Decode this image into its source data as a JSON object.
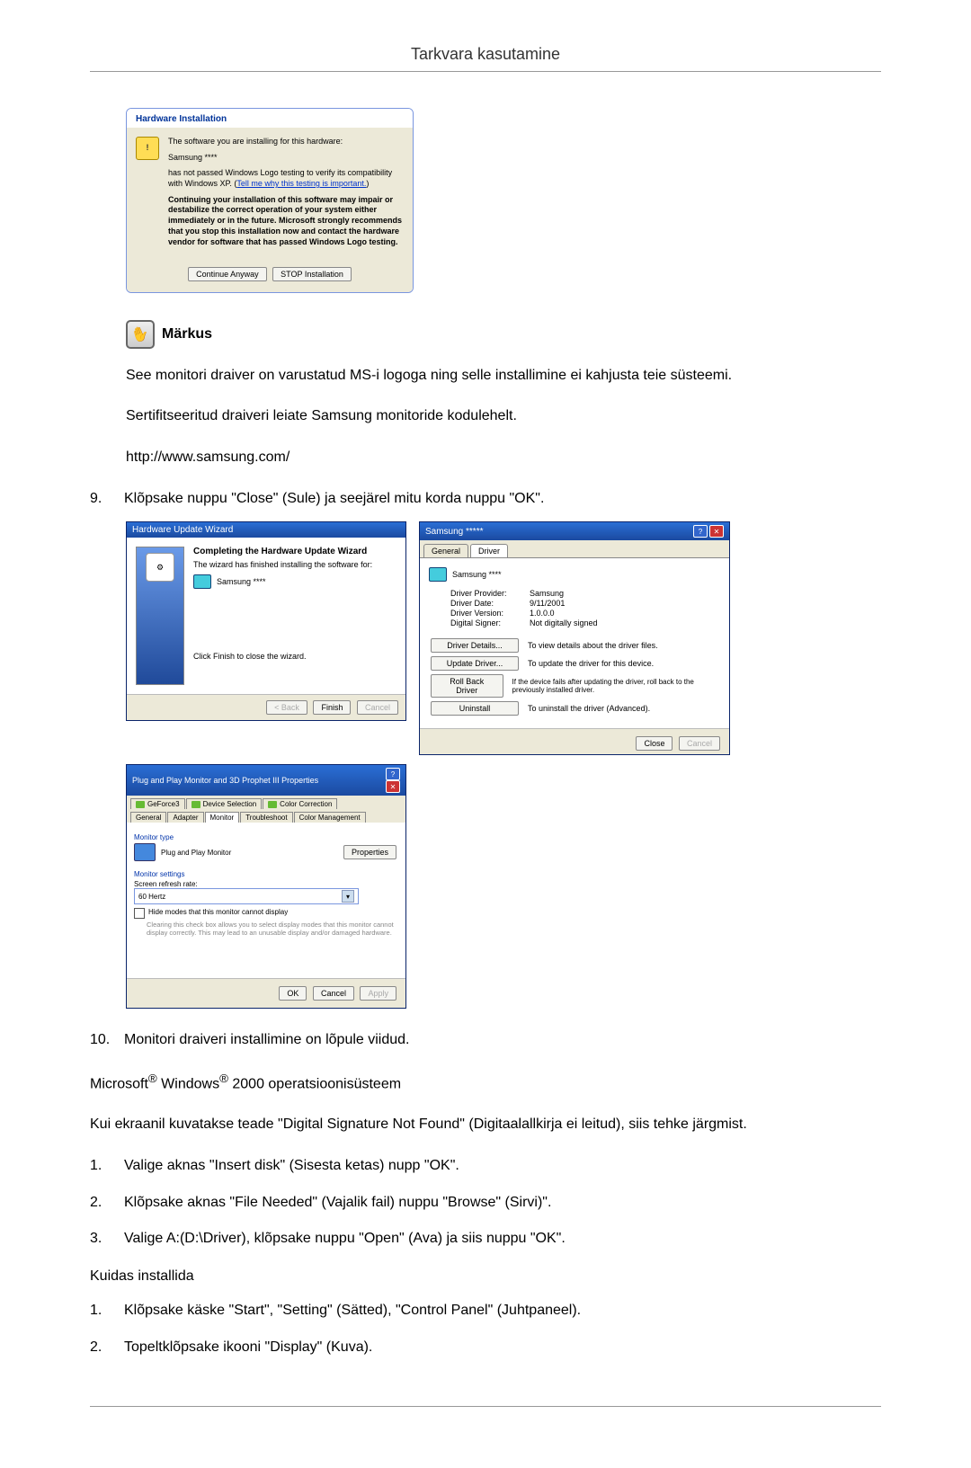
{
  "header": {
    "title": "Tarkvara kasutamine"
  },
  "hw_install": {
    "title": "Hardware Installation",
    "line1": "The software you are installing for this hardware:",
    "device": "Samsung ****",
    "line2a": "has not passed Windows Logo testing to verify its compatibility with Windows XP. (",
    "line2_link": "Tell me why this testing is important.",
    "line2b": ")",
    "bold_text": "Continuing your installation of this software may impair or destabilize the correct operation of your system either immediately or in the future. Microsoft strongly recommends that you stop this installation now and contact the hardware vendor for software that has passed Windows Logo testing.",
    "btn_continue": "Continue Anyway",
    "btn_stop": "STOP Installation"
  },
  "note": {
    "label": "Märkus",
    "para1": "See monitori draiver on varustatud MS-i logoga ning selle installimine ei kahjusta teie süsteemi.",
    "para2": "Sertifitseeritud draiveri leiate Samsung monitoride kodulehelt.",
    "url": "http://www.samsung.com/"
  },
  "step9_num": "9.",
  "step9": "Klõpsake nuppu \"Close\" (Sule) ja seejärel mitu korda nuppu \"OK\".",
  "wizard": {
    "title": "Hardware Update Wizard",
    "heading": "Completing the Hardware Update Wizard",
    "line1": "The wizard has finished installing the software for:",
    "device": "Samsung ****",
    "finish_hint": "Click Finish to close the wizard.",
    "btn_back": "< Back",
    "btn_finish": "Finish",
    "btn_cancel": "Cancel"
  },
  "driver": {
    "title": "Samsung *****",
    "tab_general": "General",
    "tab_driver": "Driver",
    "device": "Samsung ****",
    "provider_l": "Driver Provider:",
    "provider_v": "Samsung",
    "date_l": "Driver Date:",
    "date_v": "9/11/2001",
    "ver_l": "Driver Version:",
    "ver_v": "1.0.0.0",
    "signer_l": "Digital Signer:",
    "signer_v": "Not digitally signed",
    "btn_details": "Driver Details...",
    "btn_details_desc": "To view details about the driver files.",
    "btn_update": "Update Driver...",
    "btn_update_desc": "To update the driver for this device.",
    "btn_rollback": "Roll Back Driver",
    "btn_rollback_desc": "If the device fails after updating the driver, roll back to the previously installed driver.",
    "btn_uninstall": "Uninstall",
    "btn_uninstall_desc": "To uninstall the driver (Advanced).",
    "btn_close": "Close",
    "btn_cancel": "Cancel"
  },
  "monitor": {
    "title": "Plug and Play Monitor and 3D Prophet III Properties",
    "t_geforce": "GeForce3",
    "t_devsel": "Device Selection",
    "t_colorcorr": "Color Correction",
    "t_general": "General",
    "t_adapter": "Adapter",
    "t_monitor": "Monitor",
    "t_troubleshoot": "Troubleshoot",
    "t_colormgmt": "Color Management",
    "group_type": "Monitor type",
    "monitor_name": "Plug and Play Monitor",
    "btn_properties": "Properties",
    "group_settings": "Monitor settings",
    "refresh_label": "Screen refresh rate:",
    "refresh_value": "60 Hertz",
    "checkbox_label": "Hide modes that this monitor cannot display",
    "checkbox_desc": "Clearing this check box allows you to select display modes that this monitor cannot display correctly. This may lead to an unusable display and/or damaged hardware.",
    "btn_ok": "OK",
    "btn_cancel": "Cancel",
    "btn_apply": "Apply"
  },
  "step10_num": "10.",
  "step10": "Monitori draiveri installimine on lõpule viidud.",
  "os_line_pre": "Microsoft",
  "os_line_mid": " Windows",
  "os_line_post": " 2000 operatsioonisüsteem",
  "para_sig": "Kui ekraanil kuvatakse teade \"Digital Signature Not Found\" (Digitaalallkirja ei leitud), siis tehke järgmist.",
  "listA": {
    "n1": "1.",
    "i1": "Valige aknas \"Insert disk\" (Sisesta ketas) nupp \"OK\".",
    "n2": "2.",
    "i2": "Klõpsake aknas \"File Needed\" (Vajalik fail) nuppu \"Browse\" (Sirvi)\".",
    "n3": "3.",
    "i3": "Valige A:(D:\\Driver), klõpsake nuppu \"Open\" (Ava) ja siis nuppu \"OK\"."
  },
  "howto_title": "Kuidas installida",
  "listB": {
    "n1": "1.",
    "i1": "Klõpsake käske \"Start\", \"Setting\" (Sätted), \"Control Panel\" (Juhtpaneel).",
    "n2": "2.",
    "i2": "Topeltklõpsake ikooni \"Display\" (Kuva)."
  }
}
